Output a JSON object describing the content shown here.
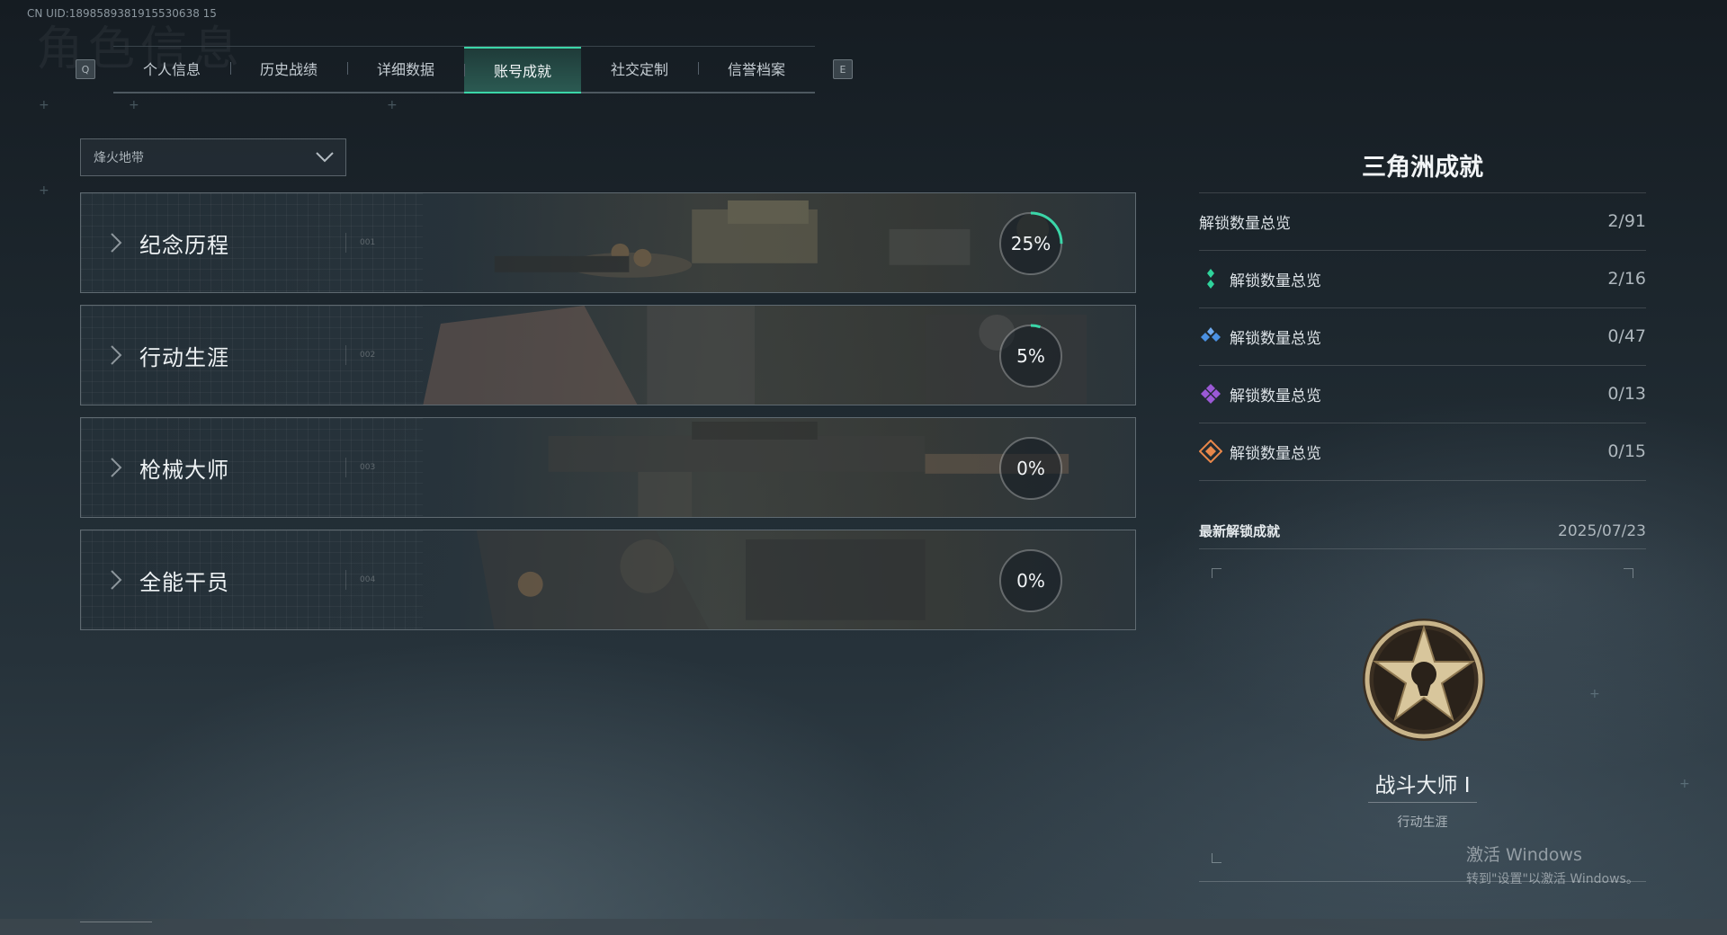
{
  "uid": "CN UID:1898589381915530638 15",
  "bg_title": "角色信息",
  "tabs": {
    "prev_key": "Q",
    "next_key": "E",
    "items": [
      {
        "label": "个人信息"
      },
      {
        "label": "历史战绩"
      },
      {
        "label": "详细数据"
      },
      {
        "label": "账号成就",
        "active": true
      },
      {
        "label": "社交定制"
      },
      {
        "label": "信誉档案"
      }
    ]
  },
  "mode_select": {
    "value": "烽火地带"
  },
  "categories": [
    {
      "title": "纪念历程",
      "index": "001",
      "percent": "25%",
      "progress": 0.25
    },
    {
      "title": "行动生涯",
      "index": "002",
      "percent": "5%",
      "progress": 0.05
    },
    {
      "title": "枪械大师",
      "index": "003",
      "percent": "0%",
      "progress": 0
    },
    {
      "title": "全能干员",
      "index": "004",
      "percent": "0%",
      "progress": 0
    }
  ],
  "summary": {
    "title": "三角洲成就",
    "total": {
      "label": "解锁数量总览",
      "value": "2/91"
    },
    "tiers": [
      {
        "icon": "green-diamond-icon",
        "color": "#2fd39b",
        "label": "解锁数量总览",
        "value": "2/16"
      },
      {
        "icon": "blue-diamond-icon",
        "color": "#4a90e2",
        "label": "解锁数量总览",
        "value": "0/47"
      },
      {
        "icon": "purple-diamond-icon",
        "color": "#9b59d6",
        "label": "解锁数量总览",
        "value": "0/13"
      },
      {
        "icon": "orange-diamond-icon",
        "color": "#e8874a",
        "label": "解锁数量总览",
        "value": "0/15"
      }
    ]
  },
  "latest": {
    "label": "最新解锁成就",
    "date": "2025/07/23",
    "name": "战斗大师 Ⅰ",
    "category": "行动生涯"
  },
  "watermark": {
    "line1": "激活 Windows",
    "line2": "转到\"设置\"以激活 Windows。"
  },
  "colors": {
    "accent": "#3bd6a8"
  }
}
